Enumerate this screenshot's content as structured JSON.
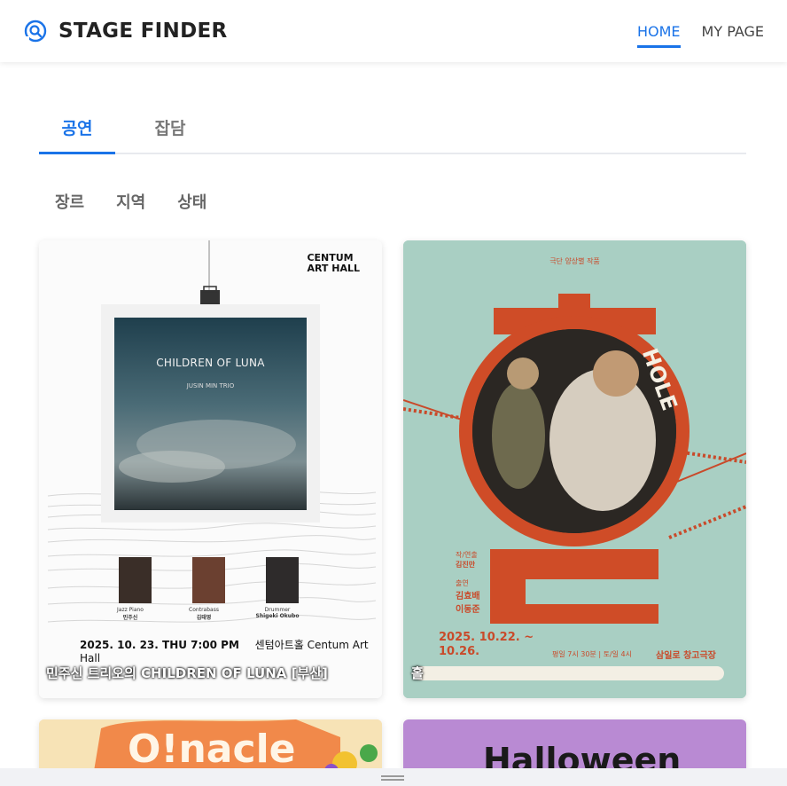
{
  "app": {
    "title": "STAGE FINDER",
    "logo_icon": "search-ticket-icon",
    "accent_color": "#1a73e8"
  },
  "nav": {
    "items": [
      {
        "label": "HOME",
        "active": true
      },
      {
        "label": "MY PAGE",
        "active": false
      }
    ]
  },
  "tabs": [
    {
      "label": "공연",
      "active": true
    },
    {
      "label": "잡담",
      "active": false
    }
  ],
  "filters": [
    {
      "label": "장르"
    },
    {
      "label": "지역"
    },
    {
      "label": "상태"
    }
  ],
  "cards": [
    {
      "title": "민주신 트리오의 CHILDREN OF LUNA [부산]",
      "poster": {
        "venue_logo_line1": "CENTUM",
        "venue_logo_line2": "ART HALL",
        "album_title": "CHILDREN OF LUNA",
        "album_subtitle": "JUSIN MIN TRIO",
        "musicians": [
          {
            "role": "Jazz Piano",
            "name": "민주신"
          },
          {
            "role": "Contrabass",
            "name": "김태영"
          },
          {
            "role": "Drummer",
            "name": "Shigeki Okubo"
          }
        ],
        "date_line": "2025. 10. 23. THU 7:00 PM",
        "venue_line": "센텀아트홀 Centum Art Hall"
      }
    },
    {
      "title": "홀",
      "poster": {
        "company": "극단 양상별 작품",
        "hole_text": "HOLE",
        "title_big": "홀",
        "director_role": "작/연출",
        "director": "김진만",
        "cast_role": "출연",
        "cast": [
          "김효배",
          "이동준"
        ],
        "dates": "2025. 10.22. ~ 10.26.",
        "times": "평일 7시 30분 | 토/일 4시",
        "venue": "삼일로 창고극장"
      }
    },
    {
      "title": "",
      "poster": {
        "headline": "O!nacle"
      }
    },
    {
      "title": "",
      "poster": {
        "headline": "Halloween"
      }
    }
  ]
}
